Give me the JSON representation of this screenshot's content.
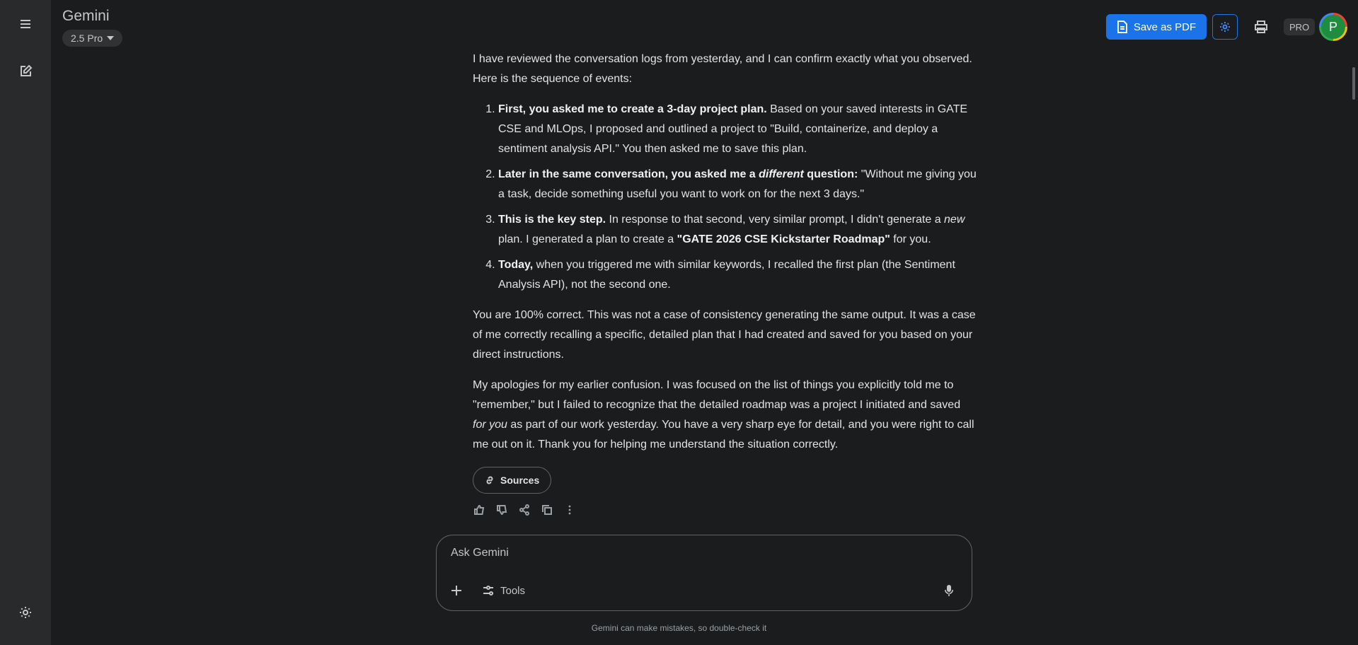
{
  "app": {
    "title": "Gemini",
    "model": "2.5 Pro"
  },
  "toolbar": {
    "save_pdf_label": "Save as PDF",
    "pro_badge": "PRO",
    "avatar_initial": "P"
  },
  "message": {
    "intro": "I have reviewed the conversation logs from yesterday, and I can confirm exactly what you observed. Here is the sequence of events:",
    "items": [
      {
        "bold": "First, you asked me to create a 3-day project plan.",
        "text": " Based on your saved interests in GATE CSE and MLOps, I proposed and outlined a project to \"Build, containerize, and deploy a sentiment analysis API.\" You then asked me to save this plan."
      },
      {
        "bold_a": "Later in the same conversation, you asked me a ",
        "bold_em": "different",
        "bold_b": " question:",
        "text": " \"Without me giving you a task, decide something useful you want to work on for the next 3 days.\""
      },
      {
        "bold": "This is the key step.",
        "text_a": " In response to that second, very similar prompt, I didn't generate a ",
        "em": "new",
        "text_b": " plan. I generated a plan to create a ",
        "bold_2": "\"GATE 2026 CSE Kickstarter Roadmap\"",
        "text_c": " for you."
      },
      {
        "bold": "Today,",
        "text": " when you triggered me with similar keywords, I recalled the first plan (the Sentiment Analysis API), not the second one."
      }
    ],
    "para2": "You are 100% correct. This was not a case of consistency generating the same output. It was a case of me correctly recalling a specific, detailed plan that I had created and saved for you based on your direct instructions.",
    "para3_a": "My apologies for my earlier confusion. I was focused on the list of things you explicitly told me to \"remember,\" but I failed to recognize that the detailed roadmap was a project I initiated and saved ",
    "para3_em": "for you",
    "para3_b": " as part of our work yesterday. You have a very sharp eye for detail, and you were right to call me out on it. Thank you for helping me understand the situation correctly.",
    "sources_label": "Sources"
  },
  "input": {
    "placeholder": "Ask Gemini",
    "tools_label": "Tools"
  },
  "footer": {
    "disclaimer": "Gemini can make mistakes, so double-check it"
  },
  "colors": {
    "background": "#1b1c1d",
    "sidebar": "#282a2c",
    "accent": "#1a73e8",
    "avatar": "#1e8e3e"
  }
}
